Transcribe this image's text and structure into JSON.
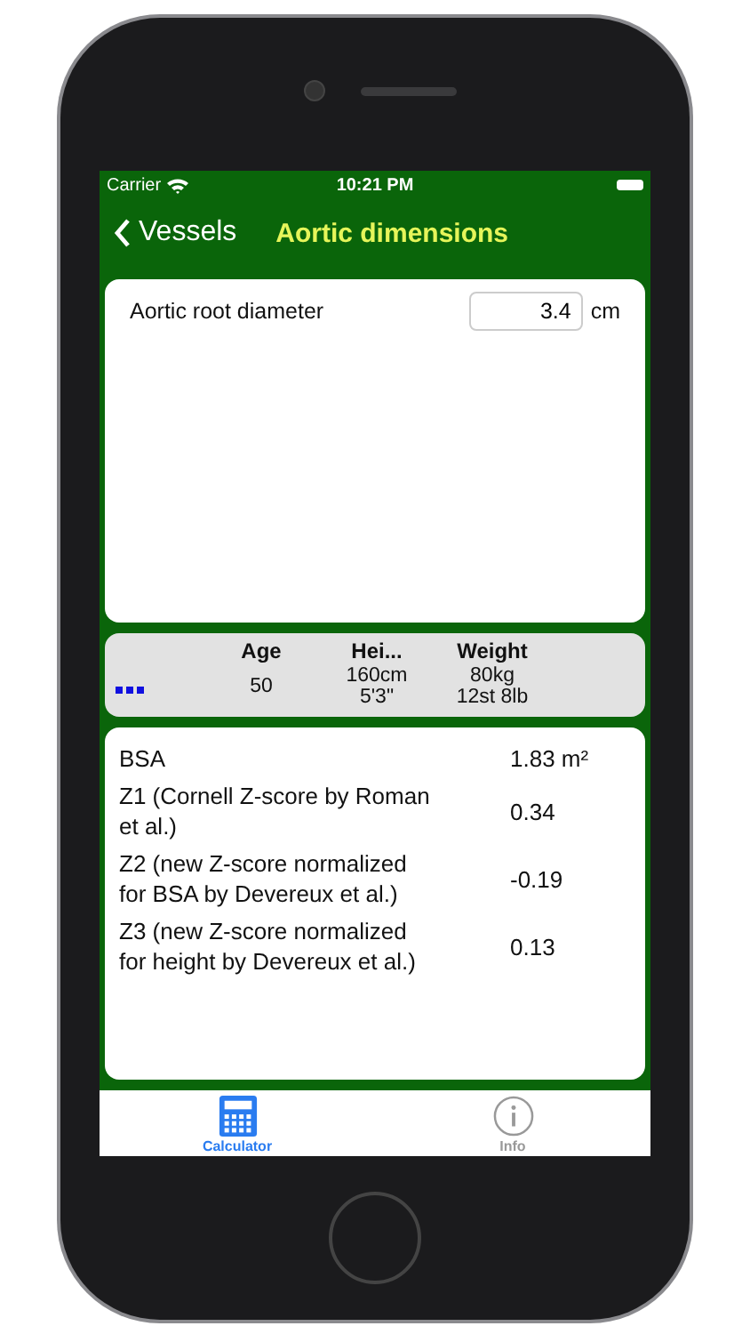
{
  "status_bar": {
    "carrier": "Carrier",
    "time": "10:21 PM"
  },
  "nav": {
    "back": "Vessels",
    "title": "Aortic dimensions"
  },
  "input": {
    "label": "Aortic root diameter",
    "value": "3.4",
    "unit": "cm"
  },
  "patient": {
    "columns": [
      {
        "header": "Age",
        "lines": [
          "50"
        ]
      },
      {
        "header": "Hei...",
        "lines": [
          "160cm",
          "5'3\""
        ]
      },
      {
        "header": "Weight",
        "lines": [
          "80kg",
          "12st 8lb"
        ]
      }
    ]
  },
  "results": [
    {
      "label": "BSA",
      "value": "1.83 m²"
    },
    {
      "label": "Z1 (Cornell Z-score by Roman et al.)",
      "value": "0.34"
    },
    {
      "label": "Z2 (new Z-score normalized for BSA by Devereux et al.)",
      "value": "-0.19"
    },
    {
      "label": "Z3 (new Z-score normalized for height by Devereux et al.)",
      "value": "0.13"
    }
  ],
  "tabs": [
    {
      "label": "Calculator",
      "kind": "calculator",
      "selected": true
    },
    {
      "label": "Info",
      "kind": "info",
      "selected": false
    }
  ]
}
